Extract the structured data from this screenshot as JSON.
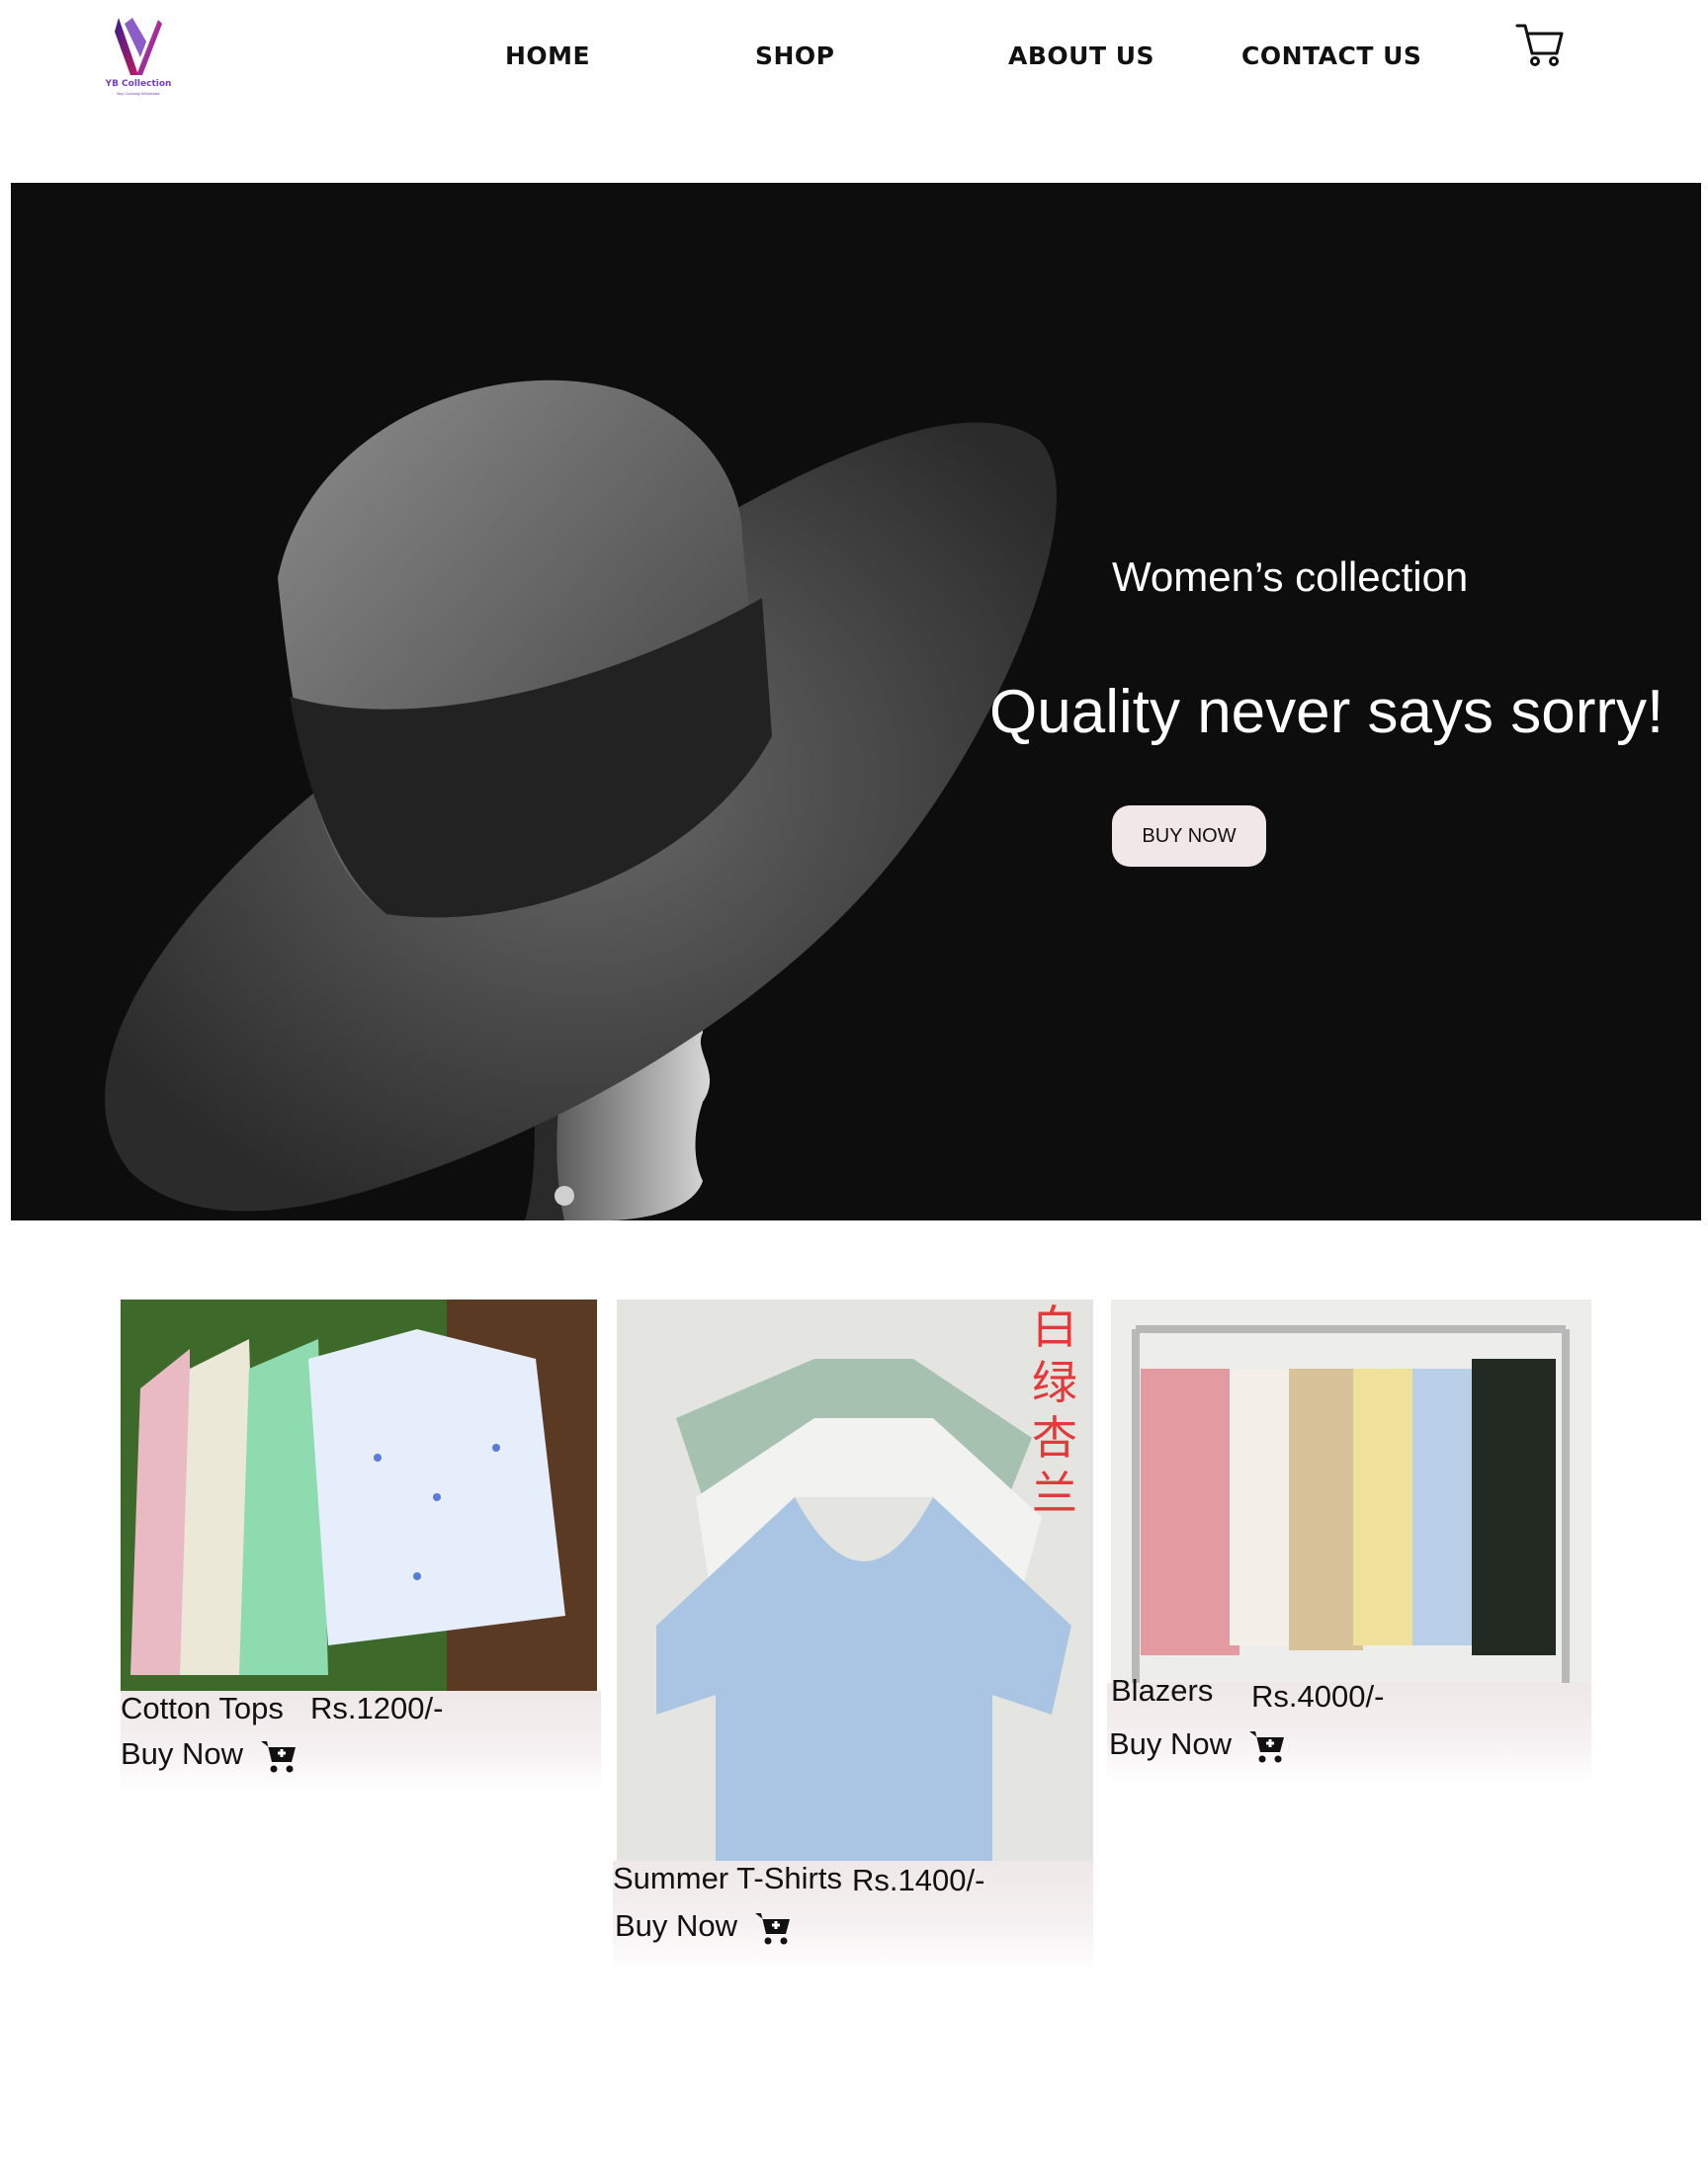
{
  "brand": {
    "logo_text": "YB Collection",
    "logo_tagline": "Buy Curiosity Wholesale",
    "accent": "#7a3fc0"
  },
  "nav": {
    "items": [
      {
        "label": "HOME"
      },
      {
        "label": "SHOP"
      },
      {
        "label": "ABOUT US"
      },
      {
        "label": "CONTACT US"
      }
    ],
    "cart_icon": "shopping-cart-icon"
  },
  "hero": {
    "kicker": "Women’s collection",
    "headline": "Quality never says sorry!",
    "button_label": "BUY NOW",
    "background": "#0d0d0e"
  },
  "products": [
    {
      "name": "Cotton Tops",
      "price": "Rs.1200/-",
      "buy_label": "Buy Now",
      "icon": "add-to-cart-icon"
    },
    {
      "name": "Summer T-Shirts",
      "price": "Rs.1400/-",
      "buy_label": "Buy Now",
      "icon": "add-to-cart-icon",
      "image_text": "白绿杏兰"
    },
    {
      "name": "Blazers",
      "price": "Rs.4000/-",
      "buy_label": "Buy Now",
      "icon": "add-to-cart-icon"
    }
  ]
}
